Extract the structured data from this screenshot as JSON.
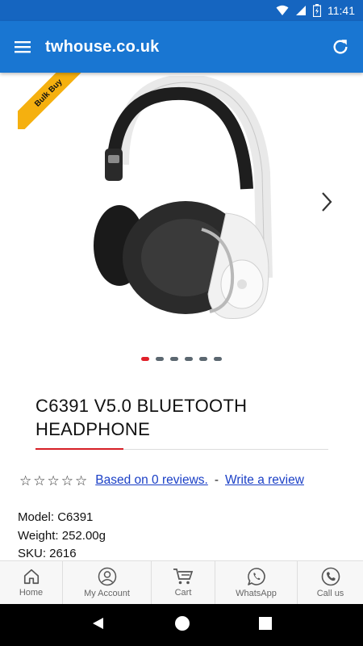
{
  "status_bar": {
    "time": "11:41"
  },
  "app_bar": {
    "title": "twhouse.co.uk",
    "menu_icon": "hamburger-menu-icon",
    "refresh_icon": "refresh-icon"
  },
  "gallery": {
    "ribbon_label": "Bulk Buy",
    "image_count": 6,
    "active_index": 0
  },
  "product": {
    "title_line1": "C6391 V5.0 BLUETOOTH",
    "title_line2": "HEADPHONE",
    "rating_stars": 0,
    "reviews_link": "Based on 0 reviews.",
    "separator": "-",
    "write_review_link": "Write a review",
    "model": "Model: C6391",
    "weight": "Weight: 252.00g",
    "sku": "SKU: 2616"
  },
  "bottom_nav": {
    "home": "Home",
    "account": "My Account",
    "cart": "Cart",
    "whatsapp": "WhatsApp",
    "call": "Call us"
  },
  "colors": {
    "app_bar": "#1976d2",
    "accent_red": "#d61f26",
    "ribbon": "#f5b00f",
    "link": "#1a3fc6"
  }
}
